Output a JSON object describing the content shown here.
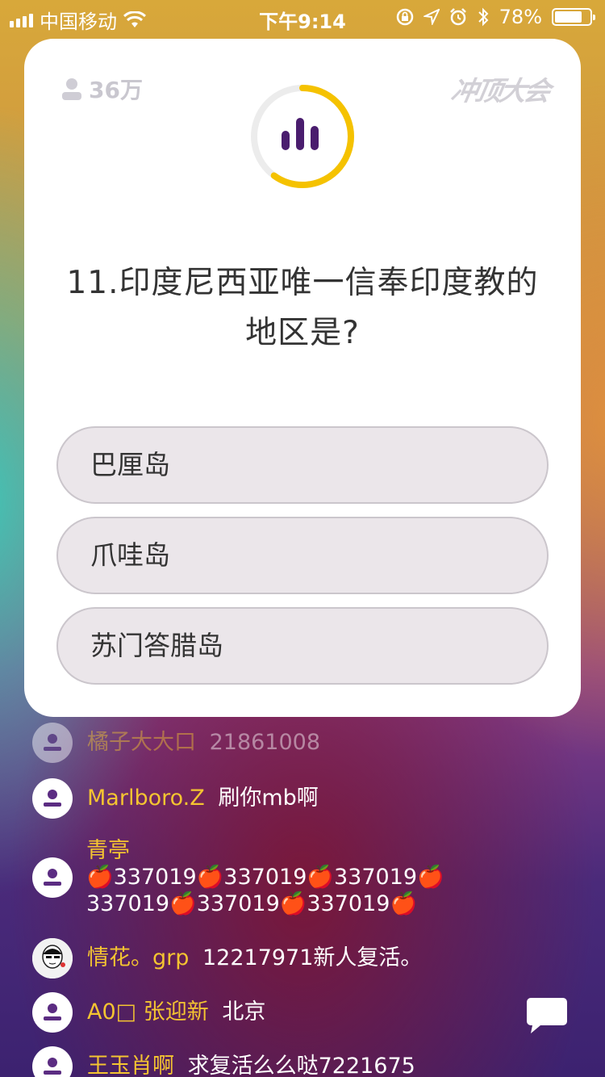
{
  "status_bar": {
    "carrier": "中国移动",
    "time": "下午9:14",
    "battery_percent": "78%",
    "battery_level": 0.78
  },
  "card": {
    "viewers": "36万",
    "logo": "冲顶大会",
    "question": "11.印度尼西亚唯一信奉印度教的地区是?",
    "timer_progress": 0.6,
    "options": [
      "巴厘岛",
      "爪哇岛",
      "苏门答腊岛"
    ]
  },
  "chat": {
    "faded_item": {
      "name": "橘子大大口",
      "message": "21861008"
    },
    "items": [
      {
        "name": "Marlboro.Z",
        "message": "刷你mb啊"
      },
      {
        "name": "青亭",
        "message_line1": "🍎337019🍎337019🍎337019🍎",
        "message_line2": "337019🍎337019🍎337019🍎"
      },
      {
        "name": "情花。grp",
        "message": "12217971新人复活。"
      },
      {
        "name": "A0□ 张迎新",
        "message": "北京"
      },
      {
        "name": "王玉肖啊",
        "message": "求复活么么哒7221675"
      }
    ]
  },
  "colors": {
    "accent_yellow": "#f5c200",
    "icon_purple": "#4a1d6e",
    "chat_name": "#f4c431"
  }
}
